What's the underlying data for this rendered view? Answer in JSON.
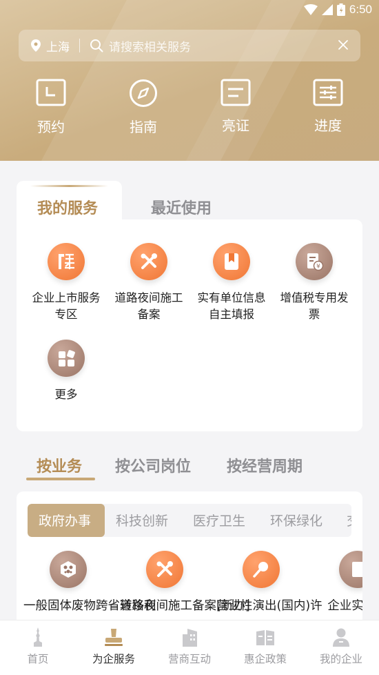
{
  "status": {
    "time": "6:50"
  },
  "search": {
    "city": "上海",
    "placeholder": "请搜索相关服务"
  },
  "quick_actions": [
    {
      "label": "预约",
      "icon": "calendar-icon"
    },
    {
      "label": "指南",
      "icon": "compass-icon"
    },
    {
      "label": "亮证",
      "icon": "id-card-icon"
    },
    {
      "label": "进度",
      "icon": "progress-sliders-icon"
    }
  ],
  "service_tabs": {
    "active": "我的服务",
    "inactive": "最近使用"
  },
  "my_services": [
    {
      "label": "企业上市服务专区",
      "icon": "listing-icon",
      "color": "orange"
    },
    {
      "label": "道路夜间施工备案",
      "icon": "tools-icon",
      "color": "orange"
    },
    {
      "label": "实有单位信息自主填报",
      "icon": "bookmark-icon",
      "color": "orange"
    },
    {
      "label": "增值税专用发票",
      "icon": "invoice-icon",
      "color": "brown"
    },
    {
      "label": "更多",
      "icon": "more-grid-icon",
      "color": "brown"
    }
  ],
  "business_tabs": [
    "按业务",
    "按公司岗位",
    "按经营周期"
  ],
  "categories": [
    "政府办事",
    "科技创新",
    "医疗卫生",
    "环保绿化",
    "交"
  ],
  "business_items": [
    {
      "label": "一般固体废物跨省转移利",
      "icon": "waste-icon",
      "color": "brown"
    },
    {
      "label": "道路夜间施工备案[新办]",
      "icon": "tools-icon",
      "color": "orange"
    },
    {
      "label": "营业性演出(国内)许",
      "icon": "microphone-icon",
      "color": "orange"
    },
    {
      "label": "企业实工作",
      "icon": "document-icon",
      "color": "brown"
    }
  ],
  "bottom_nav": [
    {
      "label": "首页",
      "icon": "home-tower-icon",
      "active": false
    },
    {
      "label": "为企服务",
      "icon": "stamp-icon",
      "active": true
    },
    {
      "label": "营商互动",
      "icon": "building-icon",
      "active": false
    },
    {
      "label": "惠企政策",
      "icon": "policy-book-icon",
      "active": false
    },
    {
      "label": "我的企业",
      "icon": "user-icon",
      "active": false
    }
  ],
  "colors": {
    "accent": "#b48c55",
    "orange": "#f07735",
    "brown": "#9a7566",
    "header": "#c9ac7d"
  }
}
